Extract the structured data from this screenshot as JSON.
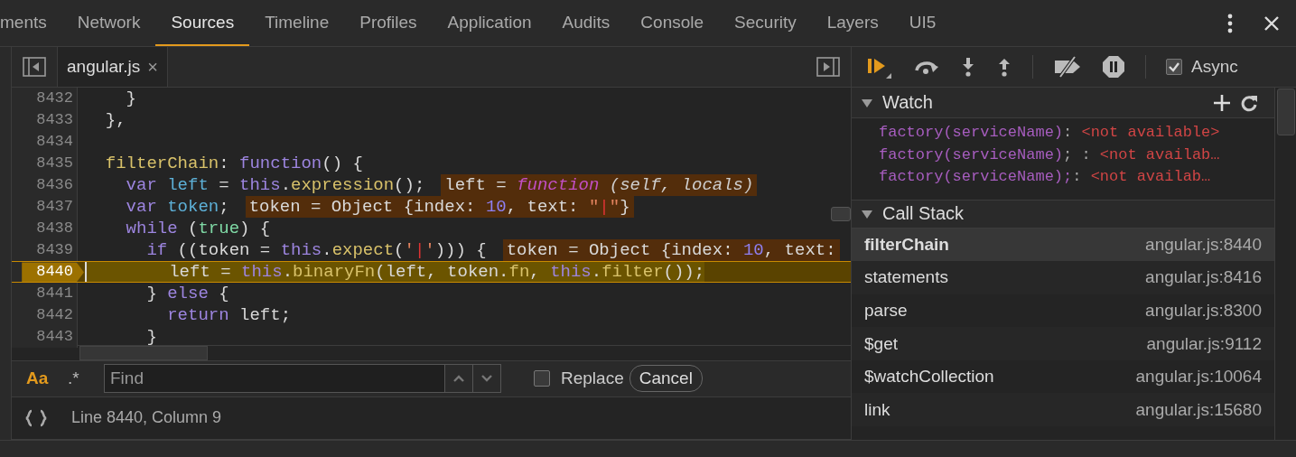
{
  "tabs": [
    {
      "label": "ments",
      "selected": false
    },
    {
      "label": "Network",
      "selected": false
    },
    {
      "label": "Sources",
      "selected": true
    },
    {
      "label": "Timeline",
      "selected": false
    },
    {
      "label": "Profiles",
      "selected": false
    },
    {
      "label": "Application",
      "selected": false
    },
    {
      "label": "Audits",
      "selected": false
    },
    {
      "label": "Console",
      "selected": false
    },
    {
      "label": "Security",
      "selected": false
    },
    {
      "label": "Layers",
      "selected": false
    },
    {
      "label": "UI5",
      "selected": false
    }
  ],
  "file_tab": {
    "label": "angular.js",
    "close": "×"
  },
  "code_lines": [
    {
      "number": "8432",
      "paused": false,
      "tokens": [
        {
          "kind": "plain",
          "text": "    }"
        }
      ]
    },
    {
      "number": "8433",
      "paused": false,
      "tokens": [
        {
          "kind": "plain",
          "text": "  },"
        }
      ]
    },
    {
      "number": "8434",
      "paused": false
    },
    {
      "number": "8435",
      "paused": false,
      "tokens": [
        {
          "kind": "prop",
          "text": "  filterChain"
        },
        {
          "kind": "plain",
          "text": ": "
        },
        {
          "kind": "keyword",
          "text": "function"
        },
        {
          "kind": "plain",
          "text": "() {"
        }
      ]
    },
    {
      "number": "8436",
      "paused": false,
      "tokens": [
        {
          "kind": "keyword",
          "text": "    var "
        },
        {
          "kind": "def",
          "text": "left"
        },
        {
          "kind": "plain",
          "text": " = "
        },
        {
          "kind": "keyword",
          "text": "this"
        },
        {
          "kind": "plain",
          "text": "."
        },
        {
          "kind": "prop",
          "text": "expression"
        },
        {
          "kind": "plain",
          "text": "();"
        }
      ],
      "annotation": [
        {
          "kind": "plain",
          "text": "left = "
        },
        {
          "kind": "fnsig",
          "text": "function"
        },
        {
          "kind": "params",
          "text": " (self, locals)"
        }
      ]
    },
    {
      "number": "8437",
      "paused": false,
      "tokens": [
        {
          "kind": "keyword",
          "text": "    var "
        },
        {
          "kind": "def",
          "text": "token"
        },
        {
          "kind": "plain",
          "text": ";"
        }
      ],
      "annotation": [
        {
          "kind": "plain",
          "text": "token = Object {index: "
        },
        {
          "kind": "number",
          "text": "10"
        },
        {
          "kind": "plain",
          "text": ", text: "
        },
        {
          "kind": "string",
          "text": "\""
        },
        {
          "kind": "error",
          "text": "|"
        },
        {
          "kind": "string",
          "text": "\""
        },
        {
          "kind": "plain",
          "text": "}"
        }
      ]
    },
    {
      "number": "8438",
      "paused": false,
      "tokens": [
        {
          "kind": "keyword",
          "text": "    while"
        },
        {
          "kind": "plain",
          "text": " ("
        },
        {
          "kind": "atom",
          "text": "true"
        },
        {
          "kind": "plain",
          "text": ") {"
        }
      ]
    },
    {
      "number": "8439",
      "paused": false,
      "tokens": [
        {
          "kind": "keyword",
          "text": "      if"
        },
        {
          "kind": "plain",
          "text": " ((token = "
        },
        {
          "kind": "keyword",
          "text": "this"
        },
        {
          "kind": "plain",
          "text": "."
        },
        {
          "kind": "prop",
          "text": "expect"
        },
        {
          "kind": "plain",
          "text": "("
        },
        {
          "kind": "string",
          "text": "'"
        },
        {
          "kind": "error",
          "text": "|"
        },
        {
          "kind": "string",
          "text": "'"
        },
        {
          "kind": "plain",
          "text": "))) {"
        }
      ],
      "annotation": [
        {
          "kind": "plain",
          "text": "token = Object {index: "
        },
        {
          "kind": "number",
          "text": "10"
        },
        {
          "kind": "plain",
          "text": ", text:"
        }
      ]
    },
    {
      "number": "8440",
      "paused": true,
      "tokens": [
        {
          "kind": "plain",
          "text": "        left = "
        },
        {
          "kind": "keyword",
          "text": "this"
        },
        {
          "kind": "plain",
          "text": "."
        },
        {
          "kind": "prop",
          "text": "binaryFn"
        },
        {
          "kind": "plain",
          "text": "(left, token."
        },
        {
          "kind": "prop",
          "text": "fn"
        },
        {
          "kind": "plain",
          "text": ", "
        },
        {
          "kind": "keyword",
          "text": "this"
        },
        {
          "kind": "plain",
          "text": "."
        },
        {
          "kind": "prop",
          "text": "filter"
        },
        {
          "kind": "plain",
          "text": "());"
        }
      ]
    },
    {
      "number": "8441",
      "paused": false,
      "tokens": [
        {
          "kind": "plain",
          "text": "      } "
        },
        {
          "kind": "keyword",
          "text": "else"
        },
        {
          "kind": "plain",
          "text": " {"
        }
      ]
    },
    {
      "number": "8442",
      "paused": false,
      "tokens": [
        {
          "kind": "keyword",
          "text": "        return"
        },
        {
          "kind": "plain",
          "text": " left;"
        }
      ]
    },
    {
      "number": "8443",
      "paused": false,
      "tokens": [
        {
          "kind": "plain",
          "text": "      }"
        }
      ]
    }
  ],
  "find_bar": {
    "toggles": [
      {
        "label": "Aa",
        "on": true
      },
      {
        "label": ".*",
        "on": false
      }
    ],
    "placeholder": "Find",
    "replace": {
      "label": "Replace",
      "checked": false
    },
    "cancel": "Cancel"
  },
  "status_bar": {
    "position": "Line 8440, Column 9"
  },
  "debugger_toolbar": {
    "async": {
      "label": "Async",
      "checked": true
    }
  },
  "watch": {
    "title": "Watch",
    "expanded": true,
    "items": [
      {
        "expression": "factory(serviceName)",
        "separator": ": ",
        "value": "<not available>"
      },
      {
        "expression": "factory(serviceName)",
        "separator": "; : ",
        "value": "<not availab…"
      },
      {
        "expression": "factory(serviceName);",
        "separator": ": ",
        "value": "<not availab…"
      }
    ]
  },
  "call_stack": {
    "title": "Call Stack",
    "expanded": true,
    "frames": [
      {
        "name": "filterChain",
        "location": "angular.js:8440",
        "selected": true
      },
      {
        "name": "statements",
        "location": "angular.js:8416",
        "selected": false
      },
      {
        "name": "parse",
        "location": "angular.js:8300",
        "selected": false
      },
      {
        "name": "$get",
        "location": "angular.js:9112",
        "selected": false
      },
      {
        "name": "$watchCollection",
        "location": "angular.js:10064",
        "selected": false
      },
      {
        "name": "link",
        "location": "angular.js:15680",
        "selected": false
      }
    ]
  }
}
